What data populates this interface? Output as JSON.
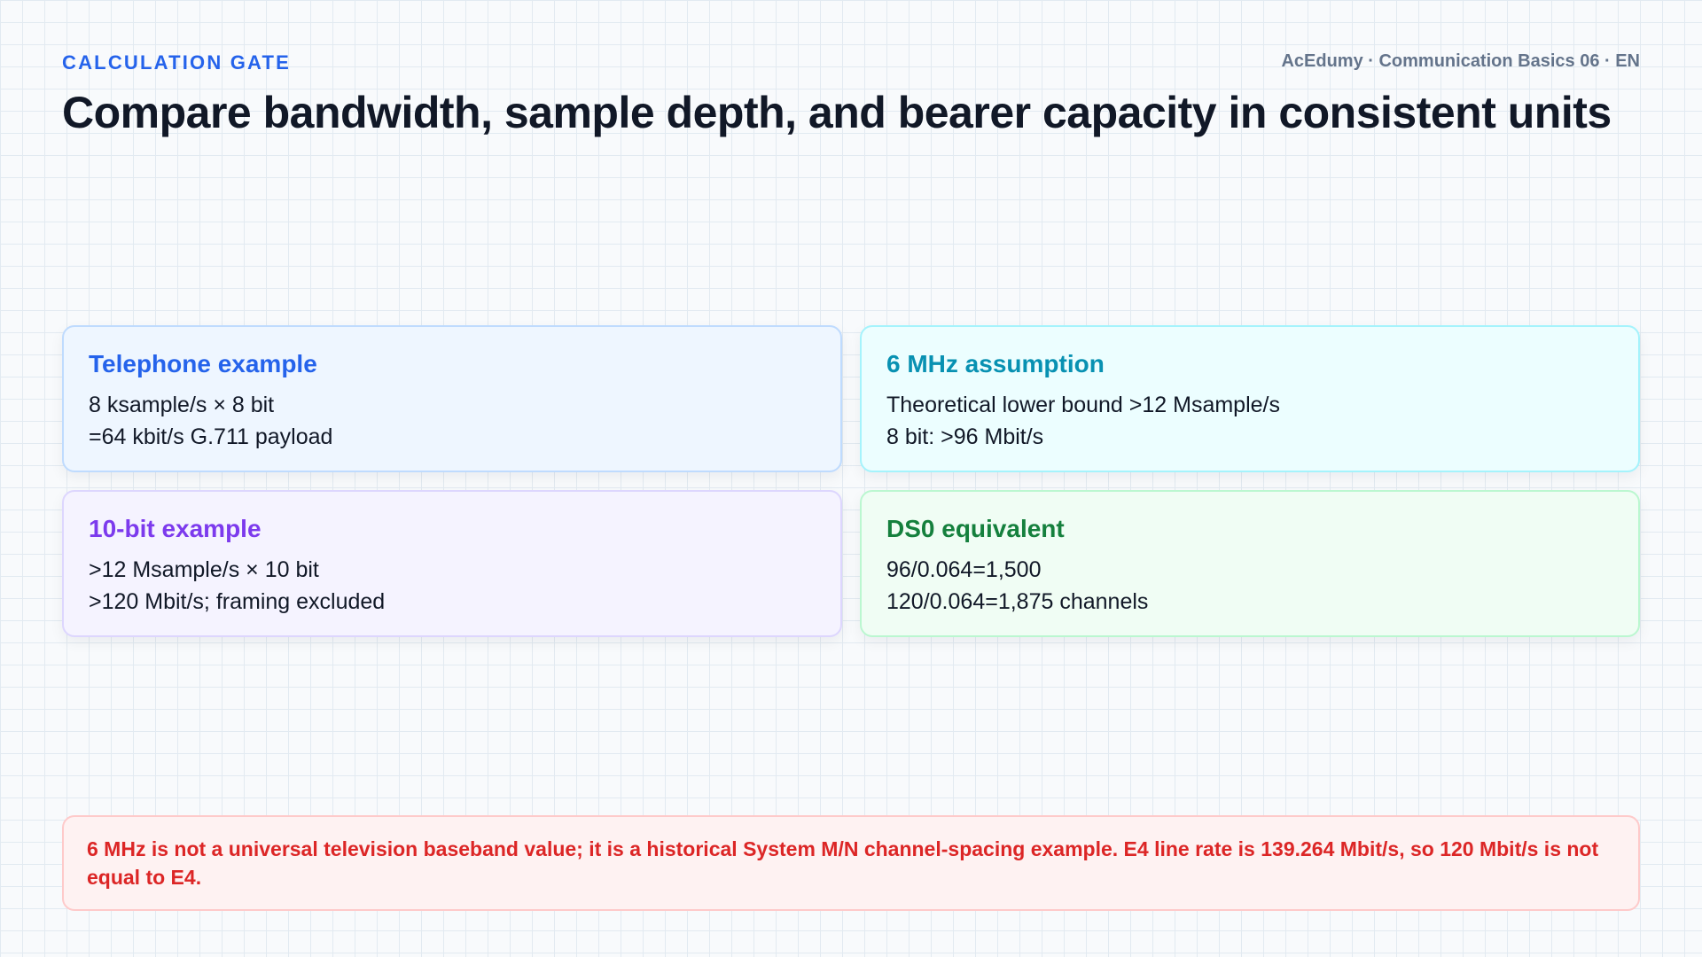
{
  "header": {
    "eyebrow": "CALCULATION GATE",
    "brand": "AcEdumy · Communication Basics 06 · EN",
    "title": "Compare bandwidth, sample depth, and bearer capacity in consistent units"
  },
  "cards": [
    {
      "title": "Telephone example",
      "lines": [
        "8 ksample/s × 8 bit",
        "=64 kbit/s G.711 payload"
      ],
      "accent": "#2563eb"
    },
    {
      "title": "6 MHz assumption",
      "lines": [
        "Theoretical lower bound >12 Msample/s",
        "8 bit: >96 Mbit/s"
      ],
      "accent": "#0891b2"
    },
    {
      "title": "10-bit example",
      "lines": [
        ">12 Msample/s × 10 bit",
        ">120 Mbit/s; framing excluded"
      ],
      "accent": "#7c3aed"
    },
    {
      "title": "DS0 equivalent",
      "lines": [
        "96/0.064=1,500",
        "120/0.064=1,875 channels"
      ],
      "accent": "#15803d"
    }
  ],
  "warning": {
    "text": "6 MHz is not a universal television baseband value; it is a historical System M/N channel-spacing example. E4 line rate is 139.264 Mbit/s, so 120 Mbit/s is not equal to E4.",
    "color": "#dc2626"
  }
}
